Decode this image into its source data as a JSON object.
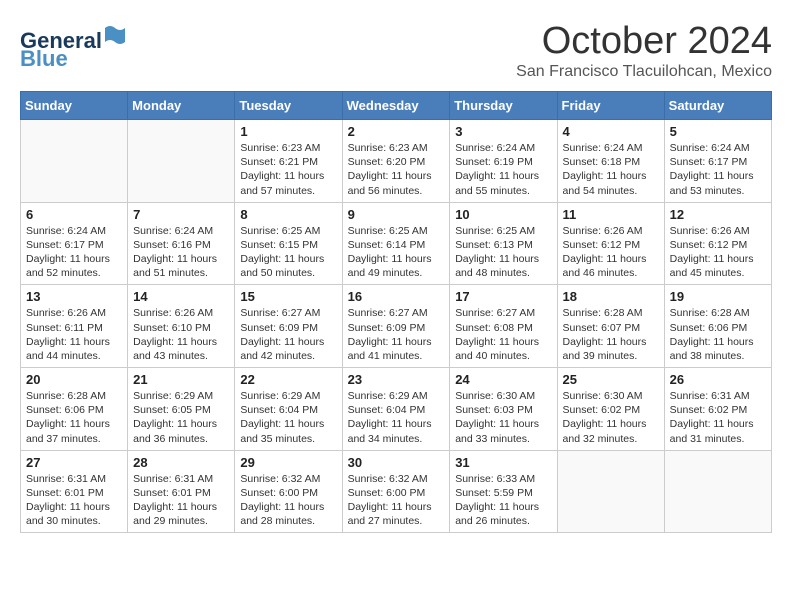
{
  "header": {
    "logo_line1": "General",
    "logo_line2": "Blue",
    "month": "October 2024",
    "location": "San Francisco Tlacuilohcan, Mexico"
  },
  "days_of_week": [
    "Sunday",
    "Monday",
    "Tuesday",
    "Wednesday",
    "Thursday",
    "Friday",
    "Saturday"
  ],
  "weeks": [
    [
      {
        "day": "",
        "info": ""
      },
      {
        "day": "",
        "info": ""
      },
      {
        "day": "1",
        "info": "Sunrise: 6:23 AM\nSunset: 6:21 PM\nDaylight: 11 hours and 57 minutes."
      },
      {
        "day": "2",
        "info": "Sunrise: 6:23 AM\nSunset: 6:20 PM\nDaylight: 11 hours and 56 minutes."
      },
      {
        "day": "3",
        "info": "Sunrise: 6:24 AM\nSunset: 6:19 PM\nDaylight: 11 hours and 55 minutes."
      },
      {
        "day": "4",
        "info": "Sunrise: 6:24 AM\nSunset: 6:18 PM\nDaylight: 11 hours and 54 minutes."
      },
      {
        "day": "5",
        "info": "Sunrise: 6:24 AM\nSunset: 6:17 PM\nDaylight: 11 hours and 53 minutes."
      }
    ],
    [
      {
        "day": "6",
        "info": "Sunrise: 6:24 AM\nSunset: 6:17 PM\nDaylight: 11 hours and 52 minutes."
      },
      {
        "day": "7",
        "info": "Sunrise: 6:24 AM\nSunset: 6:16 PM\nDaylight: 11 hours and 51 minutes."
      },
      {
        "day": "8",
        "info": "Sunrise: 6:25 AM\nSunset: 6:15 PM\nDaylight: 11 hours and 50 minutes."
      },
      {
        "day": "9",
        "info": "Sunrise: 6:25 AM\nSunset: 6:14 PM\nDaylight: 11 hours and 49 minutes."
      },
      {
        "day": "10",
        "info": "Sunrise: 6:25 AM\nSunset: 6:13 PM\nDaylight: 11 hours and 48 minutes."
      },
      {
        "day": "11",
        "info": "Sunrise: 6:26 AM\nSunset: 6:12 PM\nDaylight: 11 hours and 46 minutes."
      },
      {
        "day": "12",
        "info": "Sunrise: 6:26 AM\nSunset: 6:12 PM\nDaylight: 11 hours and 45 minutes."
      }
    ],
    [
      {
        "day": "13",
        "info": "Sunrise: 6:26 AM\nSunset: 6:11 PM\nDaylight: 11 hours and 44 minutes."
      },
      {
        "day": "14",
        "info": "Sunrise: 6:26 AM\nSunset: 6:10 PM\nDaylight: 11 hours and 43 minutes."
      },
      {
        "day": "15",
        "info": "Sunrise: 6:27 AM\nSunset: 6:09 PM\nDaylight: 11 hours and 42 minutes."
      },
      {
        "day": "16",
        "info": "Sunrise: 6:27 AM\nSunset: 6:09 PM\nDaylight: 11 hours and 41 minutes."
      },
      {
        "day": "17",
        "info": "Sunrise: 6:27 AM\nSunset: 6:08 PM\nDaylight: 11 hours and 40 minutes."
      },
      {
        "day": "18",
        "info": "Sunrise: 6:28 AM\nSunset: 6:07 PM\nDaylight: 11 hours and 39 minutes."
      },
      {
        "day": "19",
        "info": "Sunrise: 6:28 AM\nSunset: 6:06 PM\nDaylight: 11 hours and 38 minutes."
      }
    ],
    [
      {
        "day": "20",
        "info": "Sunrise: 6:28 AM\nSunset: 6:06 PM\nDaylight: 11 hours and 37 minutes."
      },
      {
        "day": "21",
        "info": "Sunrise: 6:29 AM\nSunset: 6:05 PM\nDaylight: 11 hours and 36 minutes."
      },
      {
        "day": "22",
        "info": "Sunrise: 6:29 AM\nSunset: 6:04 PM\nDaylight: 11 hours and 35 minutes."
      },
      {
        "day": "23",
        "info": "Sunrise: 6:29 AM\nSunset: 6:04 PM\nDaylight: 11 hours and 34 minutes."
      },
      {
        "day": "24",
        "info": "Sunrise: 6:30 AM\nSunset: 6:03 PM\nDaylight: 11 hours and 33 minutes."
      },
      {
        "day": "25",
        "info": "Sunrise: 6:30 AM\nSunset: 6:02 PM\nDaylight: 11 hours and 32 minutes."
      },
      {
        "day": "26",
        "info": "Sunrise: 6:31 AM\nSunset: 6:02 PM\nDaylight: 11 hours and 31 minutes."
      }
    ],
    [
      {
        "day": "27",
        "info": "Sunrise: 6:31 AM\nSunset: 6:01 PM\nDaylight: 11 hours and 30 minutes."
      },
      {
        "day": "28",
        "info": "Sunrise: 6:31 AM\nSunset: 6:01 PM\nDaylight: 11 hours and 29 minutes."
      },
      {
        "day": "29",
        "info": "Sunrise: 6:32 AM\nSunset: 6:00 PM\nDaylight: 11 hours and 28 minutes."
      },
      {
        "day": "30",
        "info": "Sunrise: 6:32 AM\nSunset: 6:00 PM\nDaylight: 11 hours and 27 minutes."
      },
      {
        "day": "31",
        "info": "Sunrise: 6:33 AM\nSunset: 5:59 PM\nDaylight: 11 hours and 26 minutes."
      },
      {
        "day": "",
        "info": ""
      },
      {
        "day": "",
        "info": ""
      }
    ]
  ]
}
